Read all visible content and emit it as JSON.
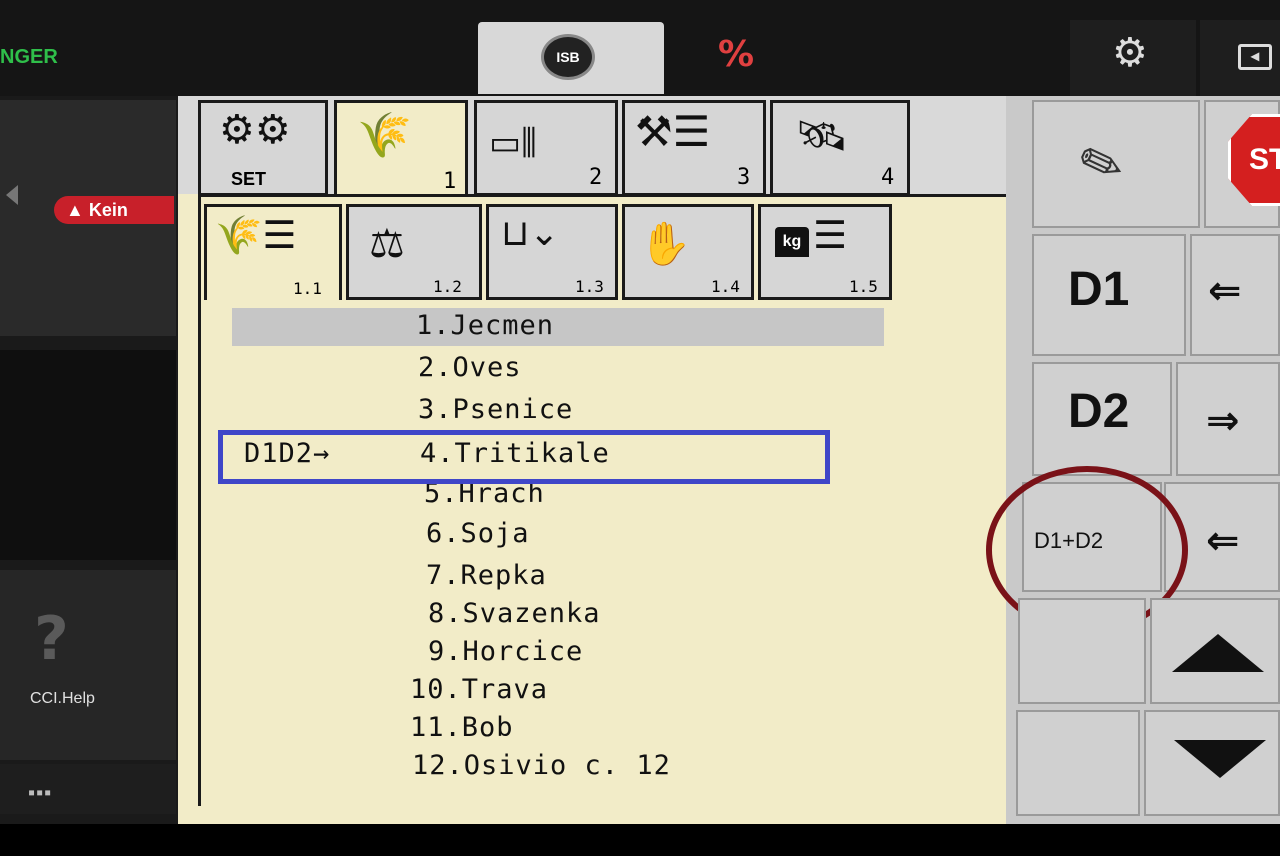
{
  "topbar": {
    "brand": "NGER",
    "isb_icon": "ISB",
    "percent_icon": "%",
    "gear_icon": "⚙",
    "exit_icon": "◂"
  },
  "sidebar": {
    "warning": "▲ Kein",
    "help_icon": "?",
    "help_label": "CCI.Help",
    "more_icon": "▪▪▪"
  },
  "tabs_row1": [
    {
      "icon": "gears",
      "label": "SET"
    },
    {
      "icon": "grain",
      "label": "1"
    },
    {
      "icon": "sensor",
      "label": "2"
    },
    {
      "icon": "tools",
      "label": "3"
    },
    {
      "icon": "satellite",
      "label": "4"
    }
  ],
  "tabs_row2": [
    {
      "icon": "grain-list",
      "label": "1.1"
    },
    {
      "icon": "scale",
      "label": "1.2"
    },
    {
      "icon": "seed-drop",
      "label": "1.3"
    },
    {
      "icon": "hand",
      "label": "1.4"
    },
    {
      "icon": "kg-weight",
      "label": "1.5",
      "kg": "kg"
    }
  ],
  "crops": [
    "1.Jecmen",
    "2.Oves",
    "3.Psenice",
    "4.Tritikale",
    "5.Hrach",
    "6.Soja",
    "7.Repka",
    "8.Svazenka",
    "9.Horcice",
    "10.Trava",
    "11.Bob",
    "12.Osivio c. 12"
  ],
  "marker_prefix": "D1D2→",
  "softkeys": {
    "pencil_icon": "✎",
    "stop_icon": "STO",
    "d1": "D1",
    "d2": "D2",
    "d1d2": "D1+D2",
    "d1_arrow": "⇐",
    "d2_arrow": "⇒",
    "d1d2_arrow": "⇐"
  }
}
